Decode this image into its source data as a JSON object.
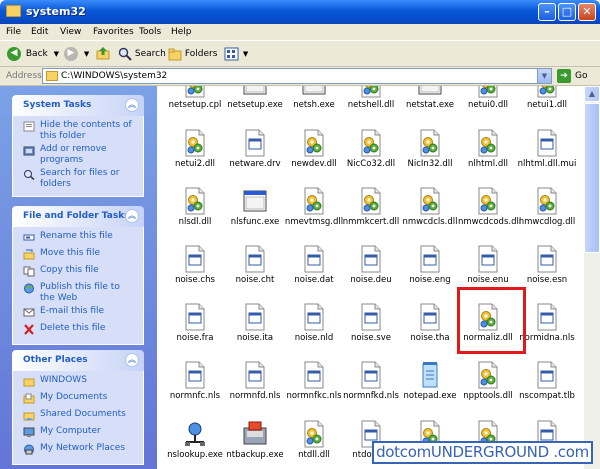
{
  "window": {
    "title": "system32"
  },
  "menu": [
    "File",
    "Edit",
    "View",
    "Favorites",
    "Tools",
    "Help"
  ],
  "toolbar": {
    "back": "Back",
    "search": "Search",
    "folders": "Folders"
  },
  "address": {
    "label": "Address",
    "path": "C:\\WINDOWS\\system32",
    "go": "Go"
  },
  "sidebar": {
    "system_tasks": {
      "title": "System Tasks",
      "items": [
        "Hide the contents of this folder",
        "Add or remove programs",
        "Search for files or folders"
      ]
    },
    "file_tasks": {
      "title": "File and Folder Tasks",
      "items": [
        "Rename this file",
        "Move this file",
        "Copy this file",
        "Publish this file to the Web",
        "E-mail this file",
        "Delete this file"
      ]
    },
    "other_places": {
      "title": "Other Places",
      "items": [
        "WINDOWS",
        "My Documents",
        "Shared Documents",
        "My Computer",
        "My Network Places"
      ]
    }
  },
  "files": [
    {
      "name": "netsetup.cpl",
      "icon": "gear-doc-icon"
    },
    {
      "name": "netsetup.exe",
      "icon": "window-icon"
    },
    {
      "name": "netsh.exe",
      "icon": "window-icon"
    },
    {
      "name": "netshell.dll",
      "icon": "gear-doc-icon"
    },
    {
      "name": "netstat.exe",
      "icon": "window-icon"
    },
    {
      "name": "netui0.dll",
      "icon": "gear-doc-icon"
    },
    {
      "name": "netui1.dll",
      "icon": "gear-doc-icon"
    },
    {
      "name": "netui2.dll",
      "icon": "gear-doc-icon"
    },
    {
      "name": "netware.drv",
      "icon": "window-doc-icon"
    },
    {
      "name": "newdev.dll",
      "icon": "gear-doc-icon"
    },
    {
      "name": "NicCo32.dll",
      "icon": "gear-doc-icon"
    },
    {
      "name": "NicIn32.dll",
      "icon": "gear-doc-icon"
    },
    {
      "name": "nlhtml.dll",
      "icon": "gear-doc-icon"
    },
    {
      "name": "nlhtml.dll.mui",
      "icon": "window-doc-icon"
    },
    {
      "name": "nlsdl.dll",
      "icon": "gear-doc-icon"
    },
    {
      "name": "nlsfunc.exe",
      "icon": "window-icon"
    },
    {
      "name": "nmevtmsg.dll",
      "icon": "gear-doc-icon"
    },
    {
      "name": "nmmkcert.dll",
      "icon": "gear-doc-icon"
    },
    {
      "name": "nmwcdcls.dll",
      "icon": "gear-doc-icon"
    },
    {
      "name": "nmwcdcods.dll",
      "icon": "gear-doc-icon"
    },
    {
      "name": "nmwcdlog.dll",
      "icon": "gear-doc-icon"
    },
    {
      "name": "noise.chs",
      "icon": "window-doc-icon"
    },
    {
      "name": "noise.cht",
      "icon": "window-doc-icon"
    },
    {
      "name": "noise.dat",
      "icon": "window-doc-icon"
    },
    {
      "name": "noise.deu",
      "icon": "window-doc-icon"
    },
    {
      "name": "noise.eng",
      "icon": "window-doc-icon"
    },
    {
      "name": "noise.enu",
      "icon": "window-doc-icon"
    },
    {
      "name": "noise.esn",
      "icon": "window-doc-icon"
    },
    {
      "name": "noise.fra",
      "icon": "window-doc-icon"
    },
    {
      "name": "noise.ita",
      "icon": "window-doc-icon"
    },
    {
      "name": "noise.nld",
      "icon": "window-doc-icon"
    },
    {
      "name": "noise.sve",
      "icon": "window-doc-icon"
    },
    {
      "name": "noise.tha",
      "icon": "window-doc-icon"
    },
    {
      "name": "normaliz.dll",
      "icon": "gear-doc-icon"
    },
    {
      "name": "normidna.nls",
      "icon": "window-doc-icon"
    },
    {
      "name": "normnfc.nls",
      "icon": "window-doc-icon"
    },
    {
      "name": "normnfd.nls",
      "icon": "window-doc-icon"
    },
    {
      "name": "normnfkc.nls",
      "icon": "window-doc-icon"
    },
    {
      "name": "normnfkd.nls",
      "icon": "window-doc-icon"
    },
    {
      "name": "notepad.exe",
      "icon": "notepad-icon"
    },
    {
      "name": "npptools.dll",
      "icon": "gear-doc-icon"
    },
    {
      "name": "nscompat.tlb",
      "icon": "window-doc-icon"
    },
    {
      "name": "nslookup.exe",
      "icon": "network-icon"
    },
    {
      "name": "ntbackup.exe",
      "icon": "backup-icon"
    },
    {
      "name": "ntdll.dll",
      "icon": "gear-doc-icon"
    },
    {
      "name": "ntdos4...",
      "icon": "window-doc-icon"
    },
    {
      "name": "",
      "icon": "gear-doc-icon"
    },
    {
      "name": "",
      "icon": "gear-doc-icon"
    },
    {
      "name": "",
      "icon": "window-doc-icon"
    }
  ],
  "selected_file": "normaliz.dll",
  "watermark": "dotcomUNDERGROUND .com",
  "colors": {
    "title_blue": "#0a57d8",
    "task_pane": "#6375d6",
    "highlight": "#e0191b"
  }
}
